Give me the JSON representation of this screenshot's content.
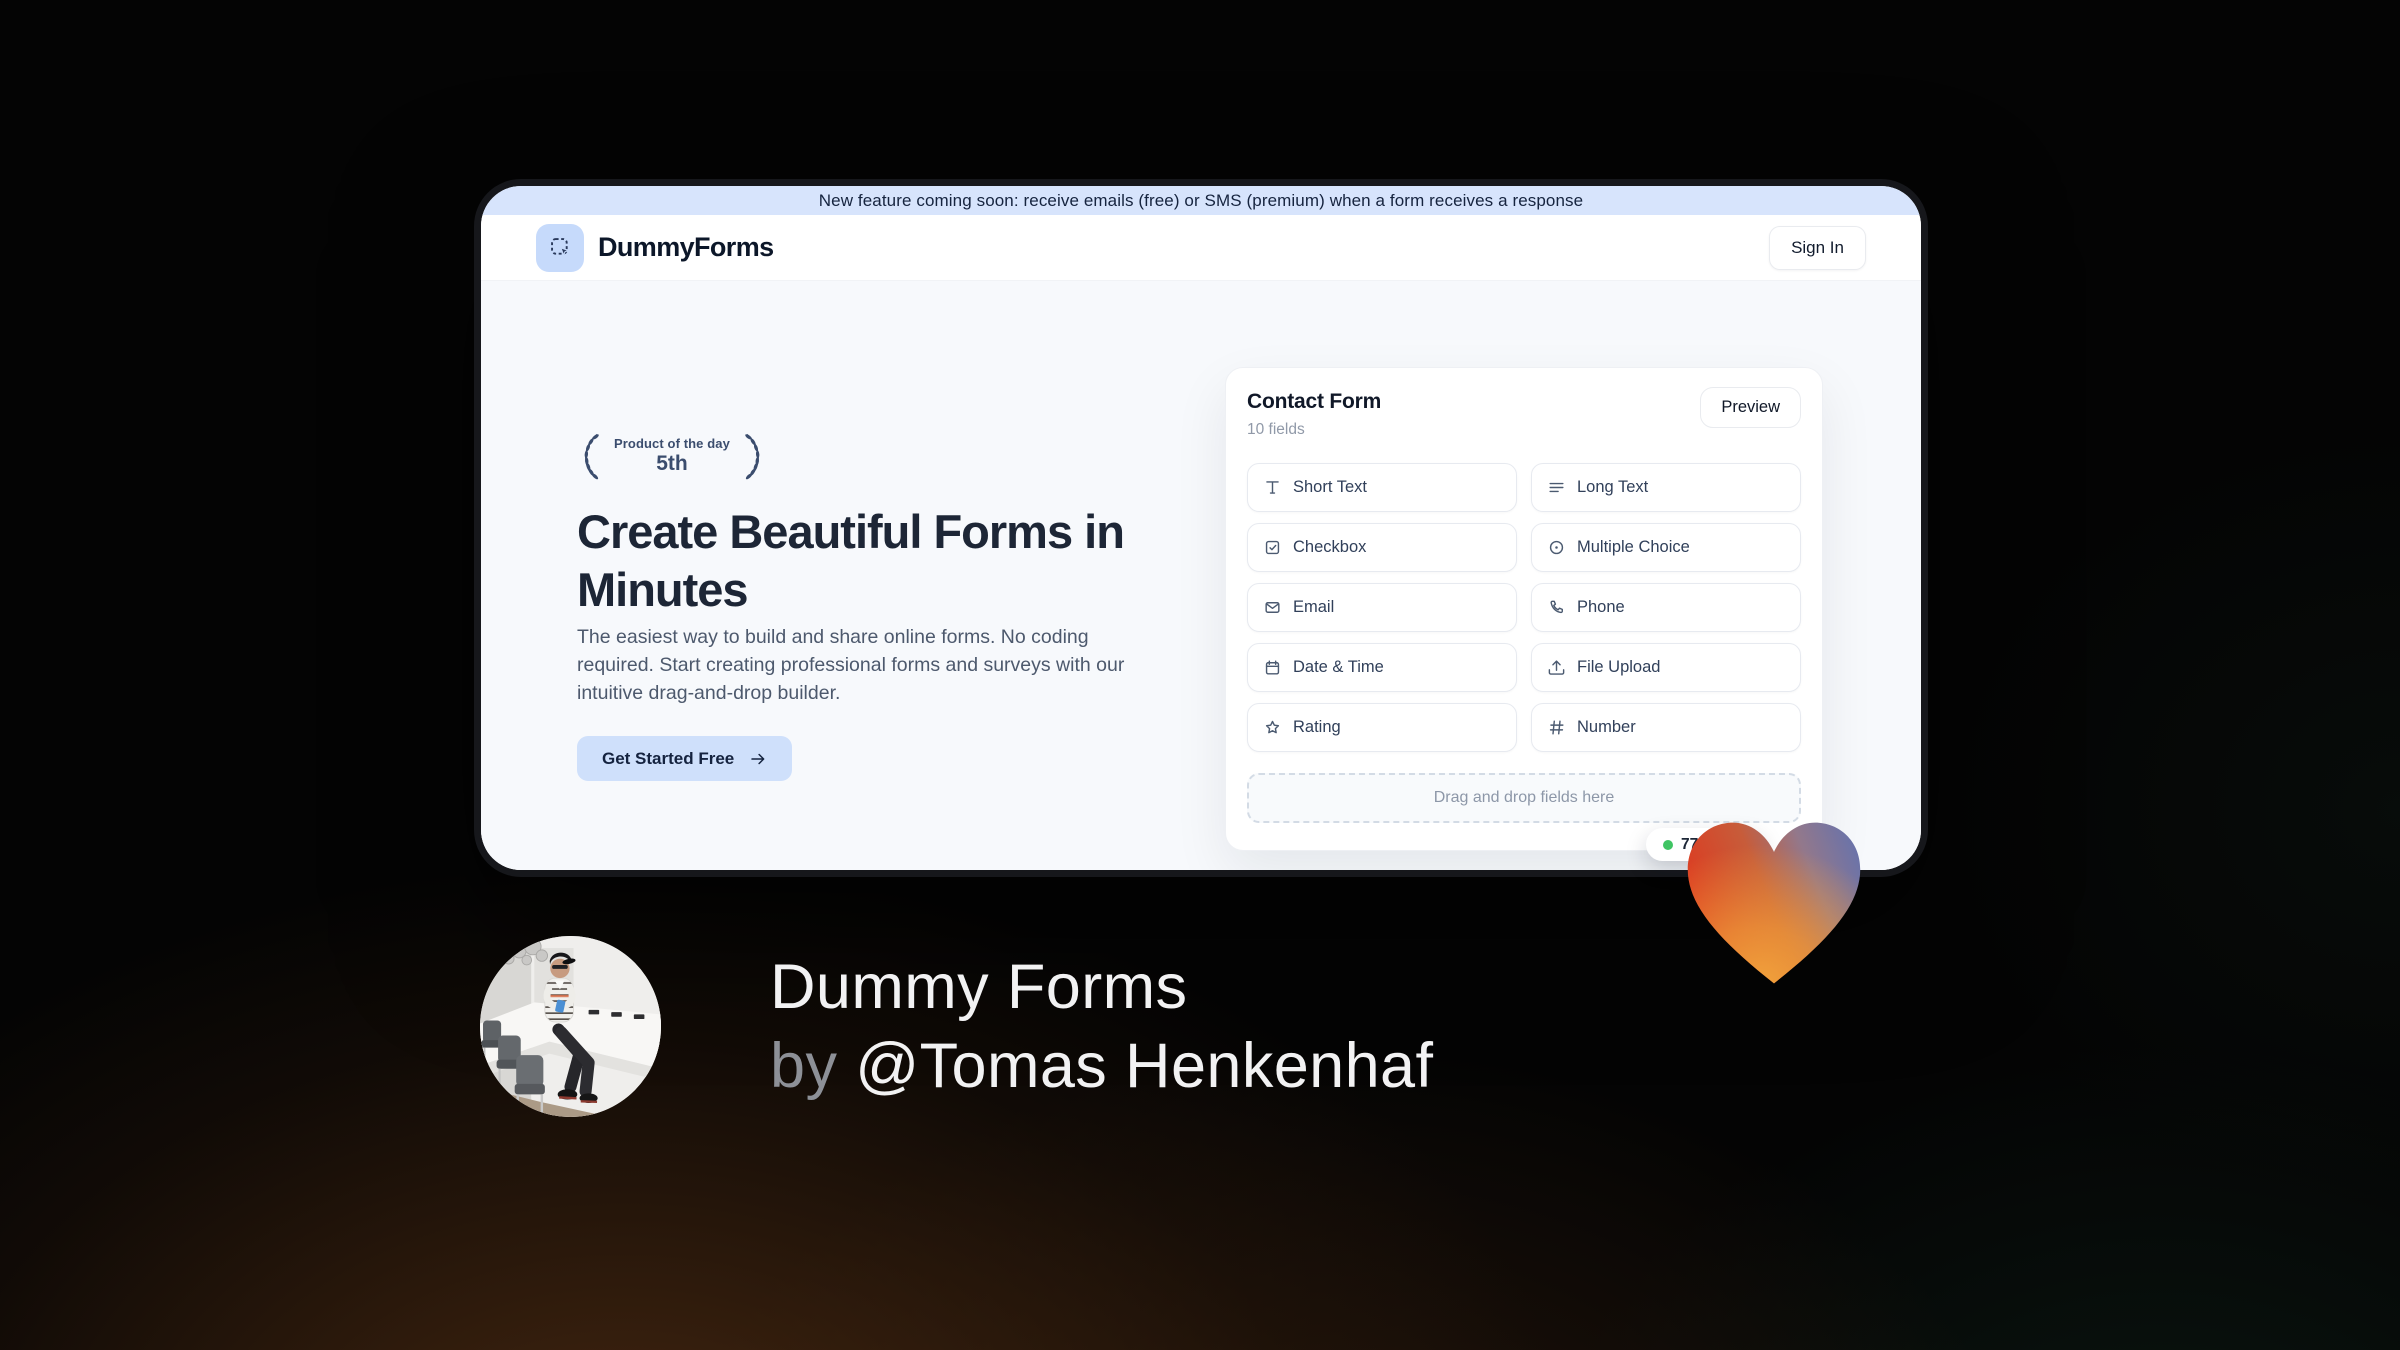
{
  "banner": {
    "text": "New feature coming soon: receive emails (free) or SMS (premium) when a form receives a response"
  },
  "header": {
    "brand": "DummyForms",
    "sign_in_label": "Sign In"
  },
  "hero": {
    "award_badge": {
      "line1": "Product of the day",
      "line2": "5th"
    },
    "headline": "Create Beautiful Forms in Minutes",
    "description": "The easiest way to build and share online forms. No coding required. Start creating professional forms and surveys with our intuitive drag-and-drop builder.",
    "cta_label": "Get Started Free"
  },
  "form_builder": {
    "title": "Contact Form",
    "fields_count": "10 fields",
    "preview_label": "Preview",
    "fields": [
      {
        "label": "Short Text",
        "icon": "icon-short-text"
      },
      {
        "label": "Long Text",
        "icon": "icon-long-text"
      },
      {
        "label": "Checkbox",
        "icon": "icon-checkbox"
      },
      {
        "label": "Multiple Choice",
        "icon": "icon-multiple-choice"
      },
      {
        "label": "Email",
        "icon": "icon-email"
      },
      {
        "label": "Phone",
        "icon": "icon-phone"
      },
      {
        "label": "Date & Time",
        "icon": "icon-calendar"
      },
      {
        "label": "File Upload",
        "icon": "icon-upload"
      },
      {
        "label": "Rating",
        "icon": "icon-star"
      },
      {
        "label": "Number",
        "icon": "icon-hash"
      }
    ],
    "dropzone_text": "Drag and drop fields here",
    "status_badge": {
      "text": "77"
    }
  },
  "attribution": {
    "title": "Dummy Forms",
    "byline_prefix": "by ",
    "author": "@Tomas Henkenhaf"
  },
  "colors": {
    "banner_bg": "#d7e4fc",
    "accent_light_blue": "#cfe0fb",
    "brand_navy": "#0c1729",
    "status_dot_green": "#3fc463",
    "heart_red": "#e03a1e",
    "heart_orange": "#f2a43c",
    "heart_blue": "#6472ae"
  }
}
